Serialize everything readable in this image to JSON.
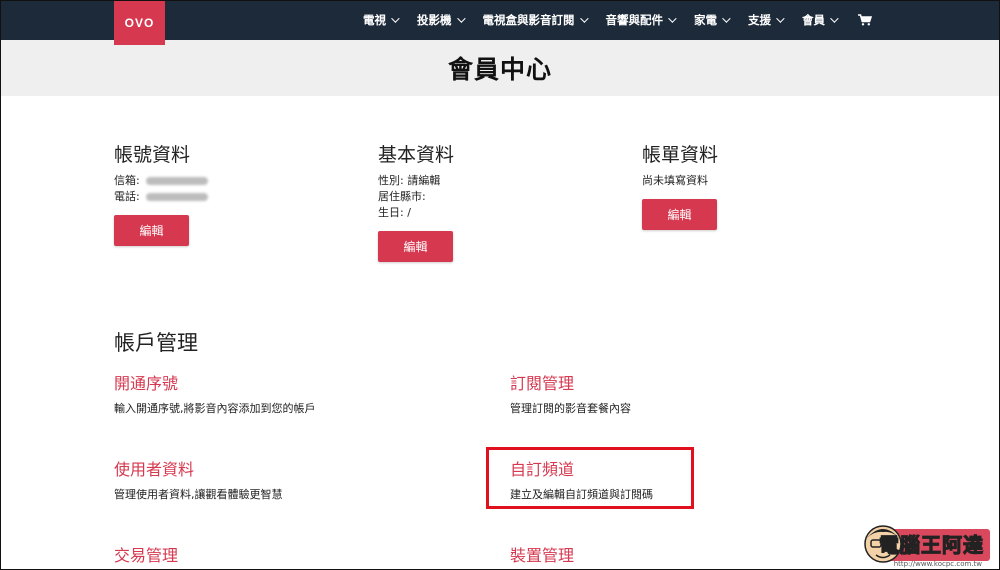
{
  "brand": {
    "logo_text": "OVO",
    "accent": "#d6384f",
    "nav_bg": "#1d2a3a"
  },
  "nav": {
    "items": [
      {
        "label": "電視"
      },
      {
        "label": "投影機"
      },
      {
        "label": "電視盒與影音訂閱"
      },
      {
        "label": "音響與配件"
      },
      {
        "label": "家電"
      },
      {
        "label": "支援"
      },
      {
        "label": "會員"
      }
    ],
    "cart_icon": "cart-icon"
  },
  "page": {
    "title": "會員中心"
  },
  "account_info": {
    "title": "帳號資料",
    "email_label": "信箱:",
    "phone_label": "電話:",
    "edit_label": "編輯"
  },
  "basic_info": {
    "title": "基本資料",
    "gender_label": "性別:",
    "gender_value": "請編輯",
    "city_label": "居住縣市:",
    "city_value": "",
    "birthday_label": "生日:",
    "birthday_value": "/",
    "edit_label": "編輯"
  },
  "billing_info": {
    "title": "帳單資料",
    "status": "尚未填寫資料",
    "edit_label": "編輯"
  },
  "account_management": {
    "title": "帳戶管理",
    "items": [
      {
        "title": "開通序號",
        "desc": "輸入開通序號,將影音內容添加到您的帳戶"
      },
      {
        "title": "訂閱管理",
        "desc": "管理訂閱的影音套餐內容"
      },
      {
        "title": "使用者資料",
        "desc": "管理使用者資料,讓觀看體驗更智慧"
      },
      {
        "title": "自訂頻道",
        "desc": "建立及編輯自訂頻道與訂閱碼"
      },
      {
        "title": "交易管理",
        "desc": ""
      },
      {
        "title": "裝置管理",
        "desc": ""
      }
    ]
  },
  "watermark": {
    "text": "電腦王阿達",
    "url": "http://www.kocpc.com.tw"
  }
}
